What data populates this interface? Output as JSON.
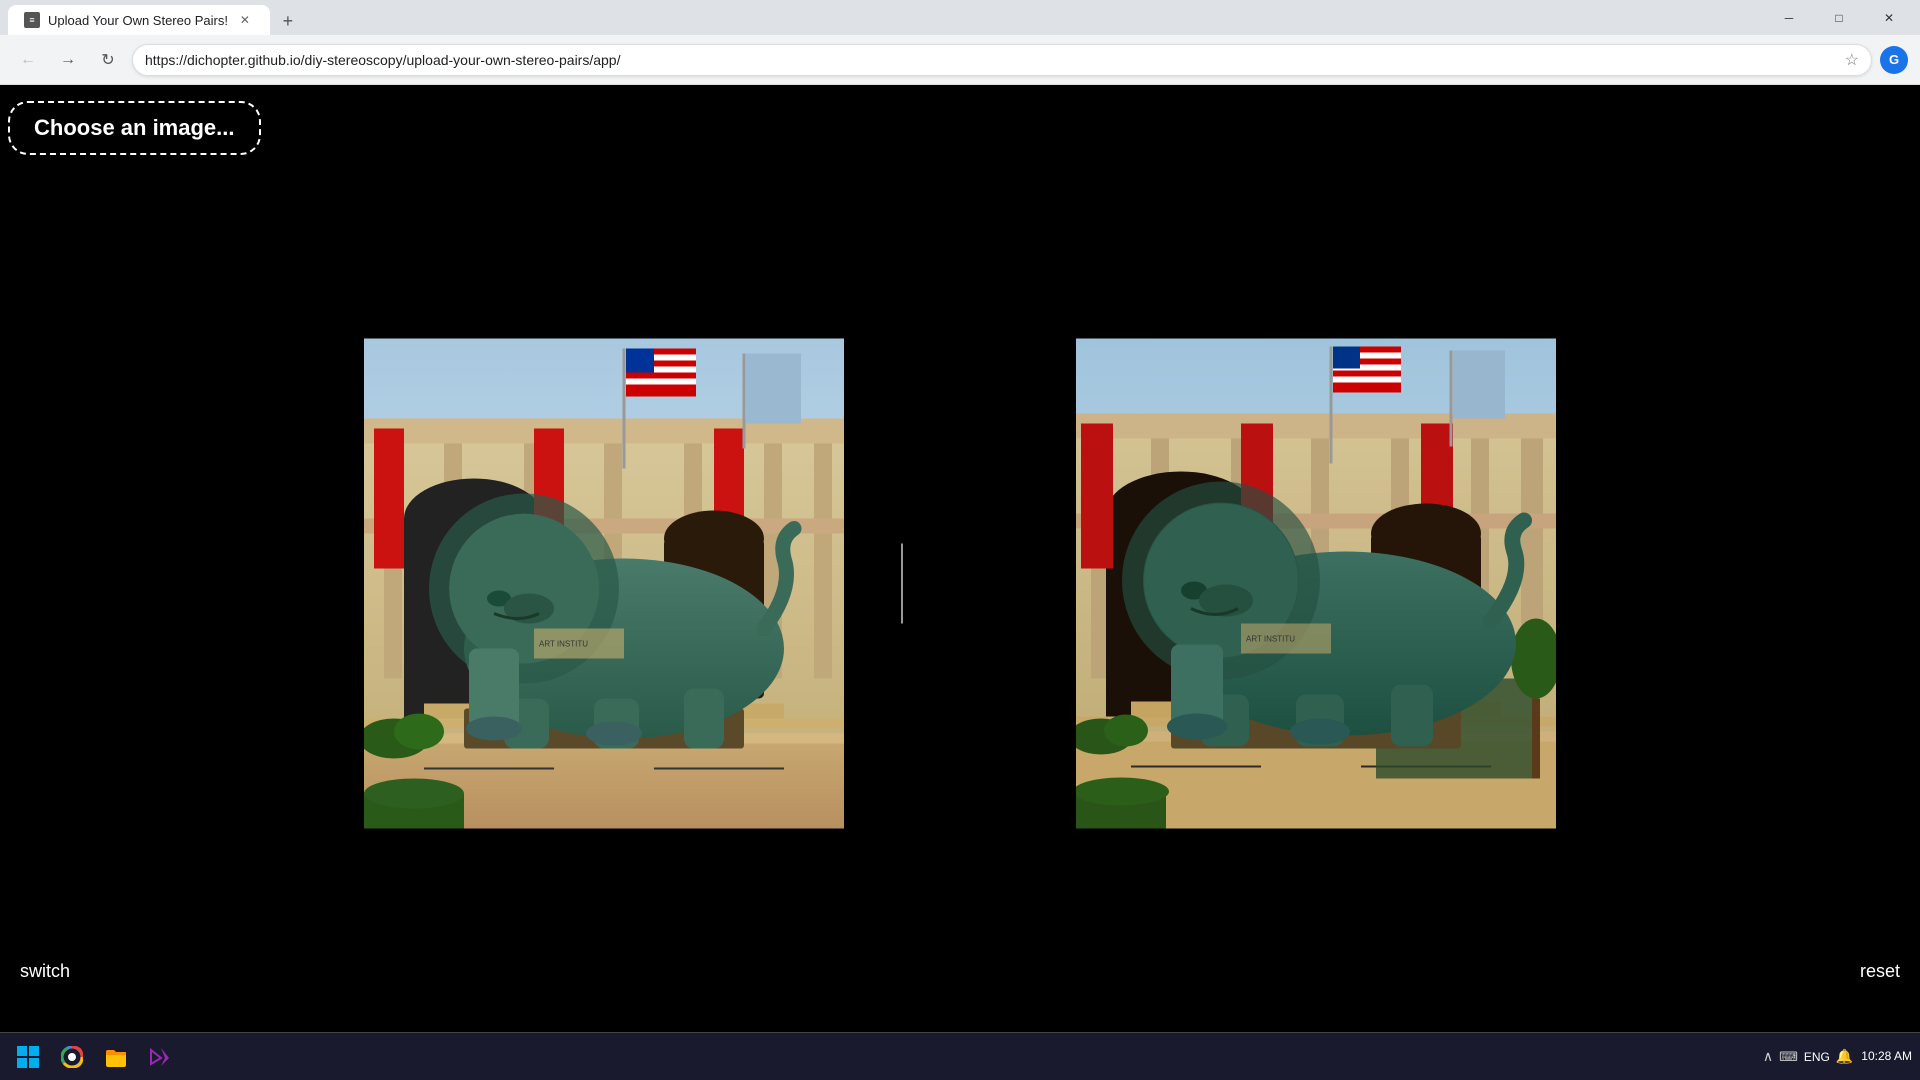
{
  "browser": {
    "tab": {
      "title": "Upload Your Own Stereo Pairs!",
      "favicon": "≡"
    },
    "url": "https://dichopter.github.io/diy-stereoscopy/upload-your-own-stereo-pairs/app/",
    "window_controls": {
      "minimize": "─",
      "maximize": "□",
      "close": "✕"
    },
    "nav": {
      "back": "←",
      "forward": "→",
      "reload": "↻"
    }
  },
  "app": {
    "background": "#000000",
    "choose_button_label": "Choose an image...",
    "switch_label": "switch",
    "reset_label": "reset",
    "divider_line": true
  },
  "taskbar": {
    "start_icon": "⊞",
    "apps": [
      {
        "name": "chrome",
        "icon": "●"
      },
      {
        "name": "file-explorer",
        "icon": "📁"
      },
      {
        "name": "visual-studio",
        "icon": "◆"
      }
    ],
    "systray": {
      "keyboard": "ENG",
      "time": "10:28 AM",
      "notifications": "🔔"
    },
    "upward_arrow": "∧"
  }
}
